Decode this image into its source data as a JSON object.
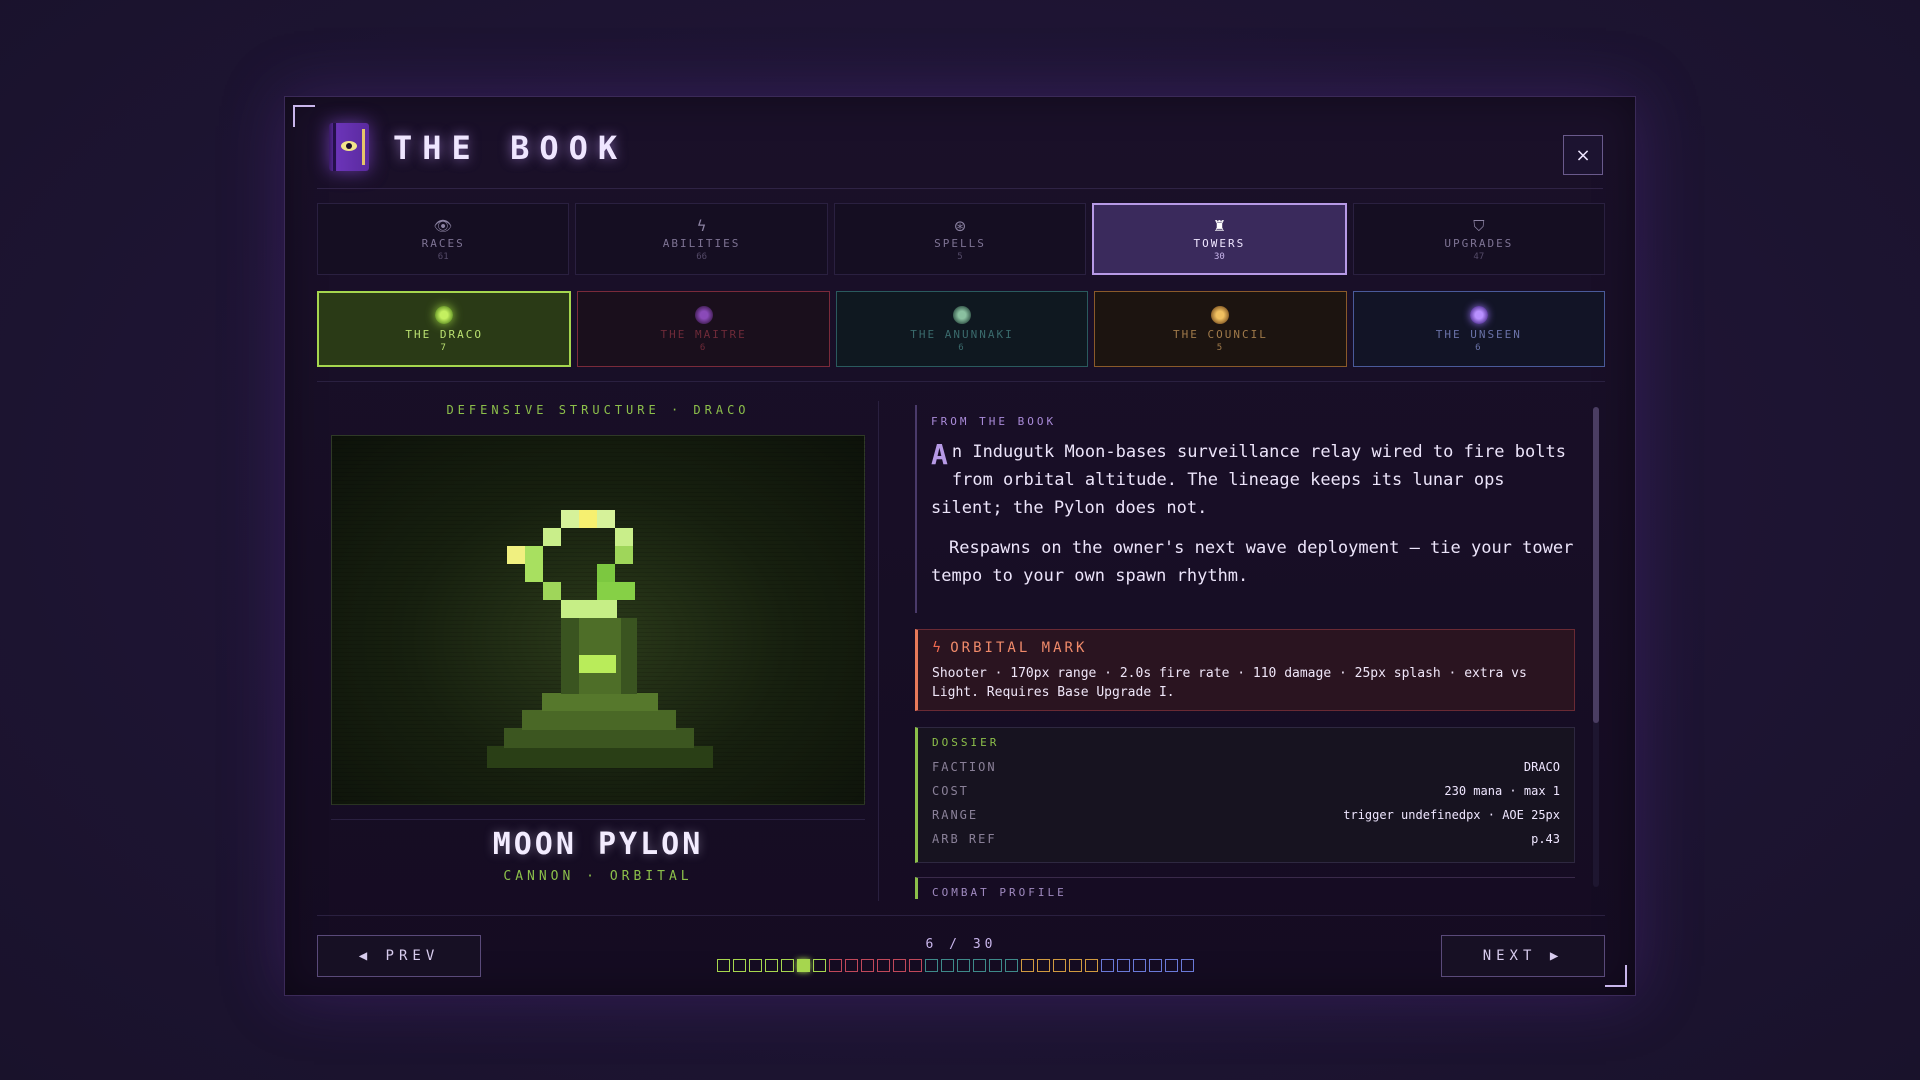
{
  "header": {
    "title": "THE BOOK",
    "close_label": "×"
  },
  "tabs": [
    {
      "label": "RACES",
      "count": "61",
      "icon": "eye-icon",
      "glyph": "👁"
    },
    {
      "label": "ABILITIES",
      "count": "66",
      "icon": "lightning-icon",
      "glyph": "ϟ"
    },
    {
      "label": "SPELLS",
      "count": "5",
      "icon": "swirl-icon",
      "glyph": "⊛"
    },
    {
      "label": "TOWERS",
      "count": "30",
      "icon": "tower-icon",
      "glyph": "♜",
      "active": true
    },
    {
      "label": "UPGRADES",
      "count": "47",
      "icon": "gem-icon",
      "glyph": "⛉"
    }
  ],
  "factions": [
    {
      "label": "THE DRACO",
      "count": "7",
      "active": true
    },
    {
      "label": "THE MAITRE",
      "count": "6"
    },
    {
      "label": "THE ANUNNAKI",
      "count": "6"
    },
    {
      "label": "THE COUNCIL",
      "count": "5"
    },
    {
      "label": "THE UNSEEN",
      "count": "6"
    }
  ],
  "item": {
    "subtitle": "DEFENSIVE STRUCTURE · DRACO",
    "name": "MOON PYLON",
    "type": "CANNON · ORBITAL"
  },
  "lore": {
    "heading": "FROM THE BOOK",
    "dropcap": "A",
    "paragraph1": "n Indugutk Moon-bases surveillance relay wired to fire bolts from orbital altitude. The lineage keeps its lunar ops silent; the Pylon does not.",
    "paragraph2": "Respawns on the owner's next wave deployment — tie your tower tempo to your own spawn rhythm."
  },
  "ability": {
    "title": "ORBITAL MARK",
    "text": "Shooter · 170px range · 2.0s fire rate · 110 damage · 25px splash · extra vs Light. Requires Base Upgrade I."
  },
  "dossier": {
    "heading": "DOSSIER",
    "rows": [
      {
        "key": "FACTION",
        "value": "DRACO"
      },
      {
        "key": "COST",
        "value": "230 mana · max 1"
      },
      {
        "key": "RANGE",
        "value": "trigger undefinedpx · AOE 25px"
      },
      {
        "key": "ARB REF",
        "value": "p.43"
      }
    ]
  },
  "combat_heading": "COMBAT PROFILE",
  "footer": {
    "prev_label": "◀ PREV",
    "next_label": "NEXT ▶",
    "page_text": "6 / 30",
    "current_page": 6,
    "total_pages": 30
  },
  "colors": {
    "accent": "#b79ae6",
    "draco": "#a6d64e",
    "maitre": "#c0485a",
    "anunnaki": "#3e8a8a",
    "council": "#d09a40",
    "unseen": "#6a7ad8"
  }
}
